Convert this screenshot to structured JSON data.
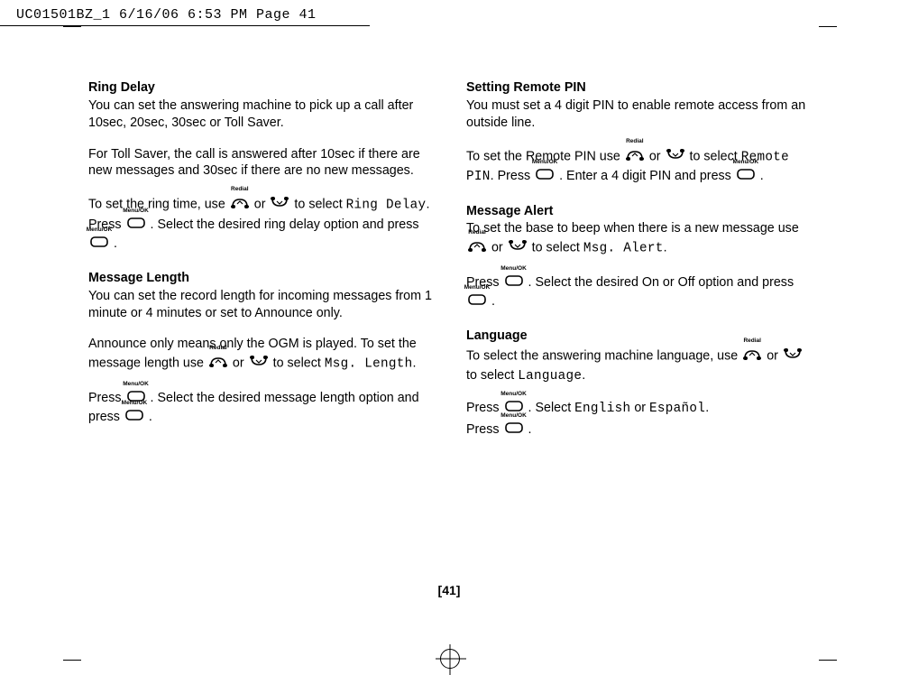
{
  "print_header": "UC01501BZ_1  6/16/06  6:53 PM  Page 41",
  "page_number": "[41]",
  "icons": {
    "up_label": "Redial",
    "down_label": "",
    "menu_label": "Menu/OK"
  },
  "left": {
    "s1": {
      "title": "Ring Delay",
      "p1": "You can set the answering machine to pick up a call after 10sec, 20sec, 30sec or Toll Saver.",
      "p2": "For Toll Saver, the call is answered after 10sec if there are new messages and 30sec if there are no new messages.",
      "p3a": "To set the ring time, use ",
      "p3b": " or ",
      "p3c": " to select ",
      "code1": "Ring Delay",
      "p3d": ". Press ",
      "p3e": " . Select the desired ring delay option and press ",
      "p3f": " ."
    },
    "s2": {
      "title": "Message Length",
      "p1": "You can set the record length for incoming messages from 1 minute or 4 minutes or set to Announce only.",
      "p2a": "Announce only means only the OGM is played. To set the message length use ",
      "p2b": " or ",
      "p2c": " to select ",
      "code1": "Msg. Length",
      "p2d": ".",
      "p3a": "Press ",
      "p3b": " . Select the desired message length option and press ",
      "p3c": " ."
    }
  },
  "right": {
    "s1": {
      "title": "Setting Remote PIN",
      "p1": "You must set a 4 digit PIN to enable remote access from an outside line.",
      "p2a": "To set the Remote PIN use ",
      "p2b": " or ",
      "p2c": " to select ",
      "code1": "Remote PIN",
      "p2d": ". Press ",
      "p2e": " . Enter a 4 digit PIN and press ",
      "p2f": " ."
    },
    "s2": {
      "title": "Message Alert",
      "p1a": "To set the base to beep when there is a new message use ",
      "p1b": " or ",
      "p1c": " to select ",
      "code1": "Msg. Alert",
      "p1d": ".",
      "p2a": "Press ",
      "p2b": " . Select the desired On or Off option and press ",
      "p2c": " ."
    },
    "s3": {
      "title": "Language",
      "p1a": "To select the answering machine language, use ",
      "p1b": " or ",
      "p1c": " to select ",
      "code1": "Language",
      "p1d": ".",
      "p2a": "Press ",
      "p2b": " . Select ",
      "code2": "English",
      "p2c": " or ",
      "code3": "Español",
      "p2d": ".",
      "p3a": "Press ",
      "p3b": " ."
    }
  }
}
